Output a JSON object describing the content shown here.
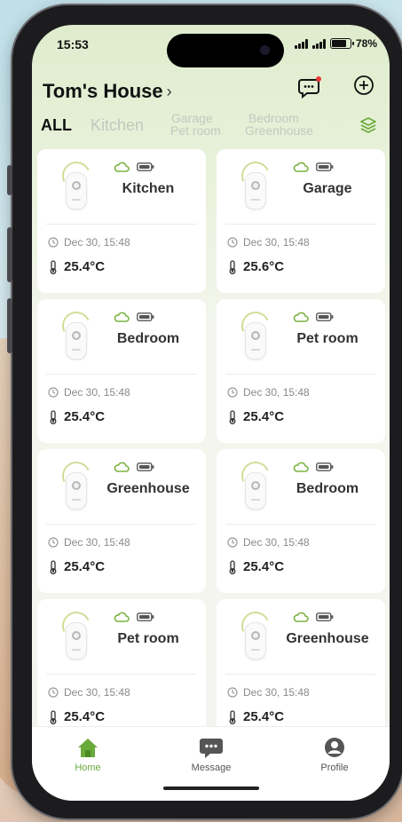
{
  "status_bar": {
    "time": "15:53",
    "battery_percent": "78%",
    "battery_level": 0.78
  },
  "header": {
    "home_name": "Tom's House",
    "chevron": "›",
    "message_icon": "message-icon",
    "add_icon": "plus-circle-icon"
  },
  "tabs": [
    {
      "label": "ALL",
      "active": true
    },
    {
      "label": "Kitchen",
      "active": false
    },
    {
      "line1": "Garage",
      "line2": "Pet room",
      "active": false
    },
    {
      "line1": "Bedroom",
      "line2": "Greenhouse",
      "active": false
    }
  ],
  "colors": {
    "accent": "#6aaa3a",
    "device_arc": "#d3db97",
    "cloud": "#7cb342"
  },
  "cards": [
    {
      "room": "Kitchen",
      "timestamp": "Dec 30, 15:48",
      "temperature": "25.4°C"
    },
    {
      "room": "Garage",
      "timestamp": "Dec 30, 15:48",
      "temperature": "25.6°C"
    },
    {
      "room": "Bedroom",
      "timestamp": "Dec 30, 15:48",
      "temperature": "25.4°C"
    },
    {
      "room": "Pet room",
      "timestamp": "Dec 30, 15:48",
      "temperature": "25.4°C"
    },
    {
      "room": "Greenhouse",
      "timestamp": "Dec 30, 15:48",
      "temperature": "25.4°C"
    },
    {
      "room": "Bedroom",
      "timestamp": "Dec 30, 15:48",
      "temperature": "25.4°C"
    },
    {
      "room": "Pet room",
      "timestamp": "Dec 30, 15:48",
      "temperature": "25.4°C"
    },
    {
      "room": "Greenhouse",
      "timestamp": "Dec 30, 15:48",
      "temperature": "25.4°C"
    }
  ],
  "tabbar": [
    {
      "label": "Home",
      "icon": "home-icon",
      "active": true
    },
    {
      "label": "Message",
      "icon": "message-icon",
      "active": false
    },
    {
      "label": "Profile",
      "icon": "profile-icon",
      "active": false
    }
  ]
}
